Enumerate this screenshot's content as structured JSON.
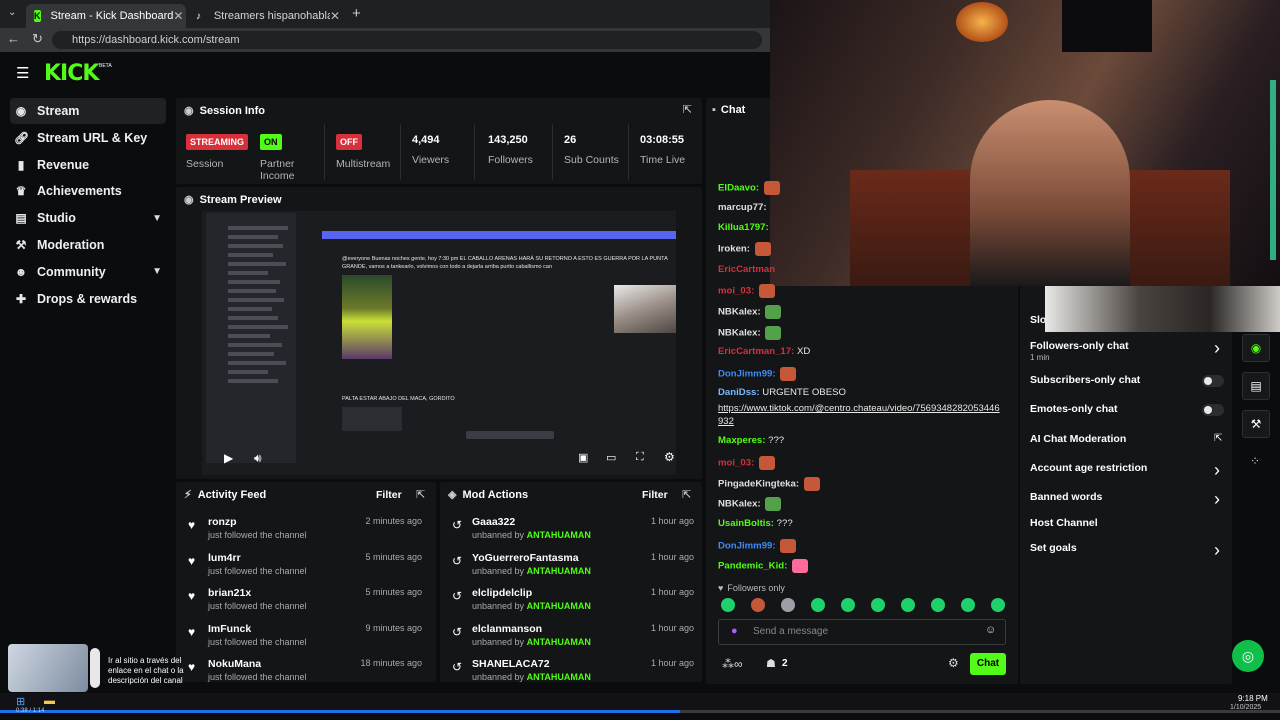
{
  "browser": {
    "tabs": [
      {
        "title": "Stream - Kick Dashboard",
        "active": true
      },
      {
        "title": "Streamers hispanohablantes más ...",
        "active": false
      }
    ],
    "url": "https://dashboard.kick.com/stream"
  },
  "app": {
    "logo": "KICK",
    "logo_tag": "BETA",
    "accent": "#53fc18"
  },
  "sidebar": {
    "items": [
      {
        "label": "Stream",
        "icon": "broadcast-icon",
        "selected": true
      },
      {
        "label": "Stream URL & Key",
        "icon": "link-icon"
      },
      {
        "label": "Revenue",
        "icon": "chart-icon"
      },
      {
        "label": "Achievements",
        "icon": "trophy-icon"
      },
      {
        "label": "Studio",
        "icon": "layers-icon",
        "expandable": true
      },
      {
        "label": "Moderation",
        "icon": "gavel-icon"
      },
      {
        "label": "Community",
        "icon": "people-icon",
        "expandable": true
      },
      {
        "label": "Drops & rewards",
        "icon": "gift-icon"
      }
    ]
  },
  "session": {
    "title": "Session Info",
    "stats": [
      {
        "value": "STREAMING",
        "label": "Session",
        "badge_color": "#d6303a"
      },
      {
        "value": "ON",
        "label": "Partner Income",
        "badge_color": "#53fc18"
      },
      {
        "value": "OFF",
        "label": "Multistream",
        "badge_color": "#d6303a"
      },
      {
        "value": "4,494",
        "label": "Viewers"
      },
      {
        "value": "143,250",
        "label": "Followers"
      },
      {
        "value": "26",
        "label": "Sub Counts"
      },
      {
        "value": "03:08:55",
        "label": "Time Live"
      }
    ]
  },
  "preview": {
    "title": "Stream Preview",
    "inner_post": "@everyone Buenas noches gente, hoy 7:30 pm EL CABALLO ARENAS HARÁ SU RETORNO A ESTO ES GUERRA POR LA PUNTA GRANDE, vamos a tankearlo, volvimos con todo a dejarla arriba purito caballismo can",
    "inner_post2": "PALTA ESTAR ABAJO DEL MACA, GORDITO"
  },
  "activity": {
    "title": "Activity Feed",
    "filter": "Filter",
    "items": [
      {
        "name": "ronzp",
        "action": "just followed the channel",
        "time": "2 minutes ago"
      },
      {
        "name": "lum4rr",
        "action": "just followed the channel",
        "time": "5 minutes ago"
      },
      {
        "name": "brian21x",
        "action": "just followed the channel",
        "time": "5 minutes ago"
      },
      {
        "name": "ImFunck",
        "action": "just followed the channel",
        "time": "9 minutes ago"
      },
      {
        "name": "NokuMana",
        "action": "just followed the channel",
        "time": "18 minutes ago"
      }
    ]
  },
  "modactions": {
    "title": "Mod Actions",
    "filter": "Filter",
    "items": [
      {
        "name": "Gaaa322",
        "action": "unbanned by",
        "by": "ANTAHUAMAN",
        "time": "1 hour ago"
      },
      {
        "name": "YoGuerreroFantasma",
        "action": "unbanned by",
        "by": "ANTAHUAMAN",
        "time": "1 hour ago"
      },
      {
        "name": "elclipdelclip",
        "action": "unbanned by",
        "by": "ANTAHUAMAN",
        "time": "1 hour ago"
      },
      {
        "name": "elclanmanson",
        "action": "unbanned by",
        "by": "ANTAHUAMAN",
        "time": "1 hour ago"
      },
      {
        "name": "SHANELACA72",
        "action": "unbanned by",
        "by": "ANTAHUAMAN",
        "time": "1 hour ago"
      }
    ]
  },
  "chat": {
    "title": "Chat",
    "messages": [
      {
        "user": "ElDaavo:",
        "color": "#53fc18",
        "text": ""
      },
      {
        "user": "marcup77:",
        "color": "#e0e0e0",
        "text": ""
      },
      {
        "user": "Killua1797:",
        "color": "#53fc18",
        "text": ""
      },
      {
        "user": "Iroken:",
        "color": "#e0e0e0",
        "text": ""
      },
      {
        "user": "EricCartman",
        "color": "#d6303a",
        "text": ""
      },
      {
        "user": "moi_03:",
        "color": "#d6303a",
        "text": ""
      },
      {
        "user": "NBKalex:",
        "color": "#e0e0e0",
        "text": ""
      },
      {
        "user": "NBKalex:",
        "color": "#e0e0e0",
        "text": ""
      },
      {
        "user": "EricCartman_17:",
        "color": "#d6303a",
        "text": "XD"
      },
      {
        "user": "DonJimm99:",
        "color": "#3e8bf5",
        "text": ""
      },
      {
        "user": "DaniDss:",
        "color": "#7ab8ff",
        "text": "URGENTE OBESO"
      },
      {
        "user": "Maxperes:",
        "color": "#53fc18",
        "text": "???"
      },
      {
        "user": "moi_03:",
        "color": "#d6303a",
        "text": ""
      },
      {
        "user": "PingadeKingteka:",
        "color": "#e0e0e0",
        "text": ""
      },
      {
        "user": "NBKalex:",
        "color": "#e0e0e0",
        "text": ""
      },
      {
        "user": "UsainBoltis:",
        "color": "#53fc18",
        "text": "???"
      },
      {
        "user": "DonJimm99:",
        "color": "#3e8bf5",
        "text": ""
      },
      {
        "user": "Pandemic_Kid:",
        "color": "#53fc18",
        "text": ""
      }
    ],
    "link": "https://www.tiktok.com/@centro.chateau/video/7569348282053446932",
    "followers_only": "Followers only",
    "placeholder": "Send a message",
    "user_count": "2",
    "send_label": "Chat"
  },
  "chat_settings": {
    "slow": "Slo",
    "items": [
      {
        "label": "Followers-only chat",
        "sub": "1 min",
        "control": "arrow"
      },
      {
        "label": "Subscribers-only chat",
        "control": "toggle"
      },
      {
        "label": "Emotes-only chat",
        "control": "toggle"
      },
      {
        "label": "AI Chat Moderation",
        "control": "external"
      },
      {
        "label": "Account age restriction",
        "control": "arrow"
      },
      {
        "label": "Banned words",
        "control": "arrow"
      },
      {
        "label": "Host Channel",
        "control": "none"
      },
      {
        "label": "Set goals",
        "control": "arrow"
      }
    ]
  },
  "overlay": {
    "caption": "Ir al sitio a través del enlace en el chat o la descripción del canal"
  },
  "taskbar": {
    "time": "9:18 PM",
    "date": "1/10/2025",
    "video_time": "0:38 / 1:14"
  }
}
